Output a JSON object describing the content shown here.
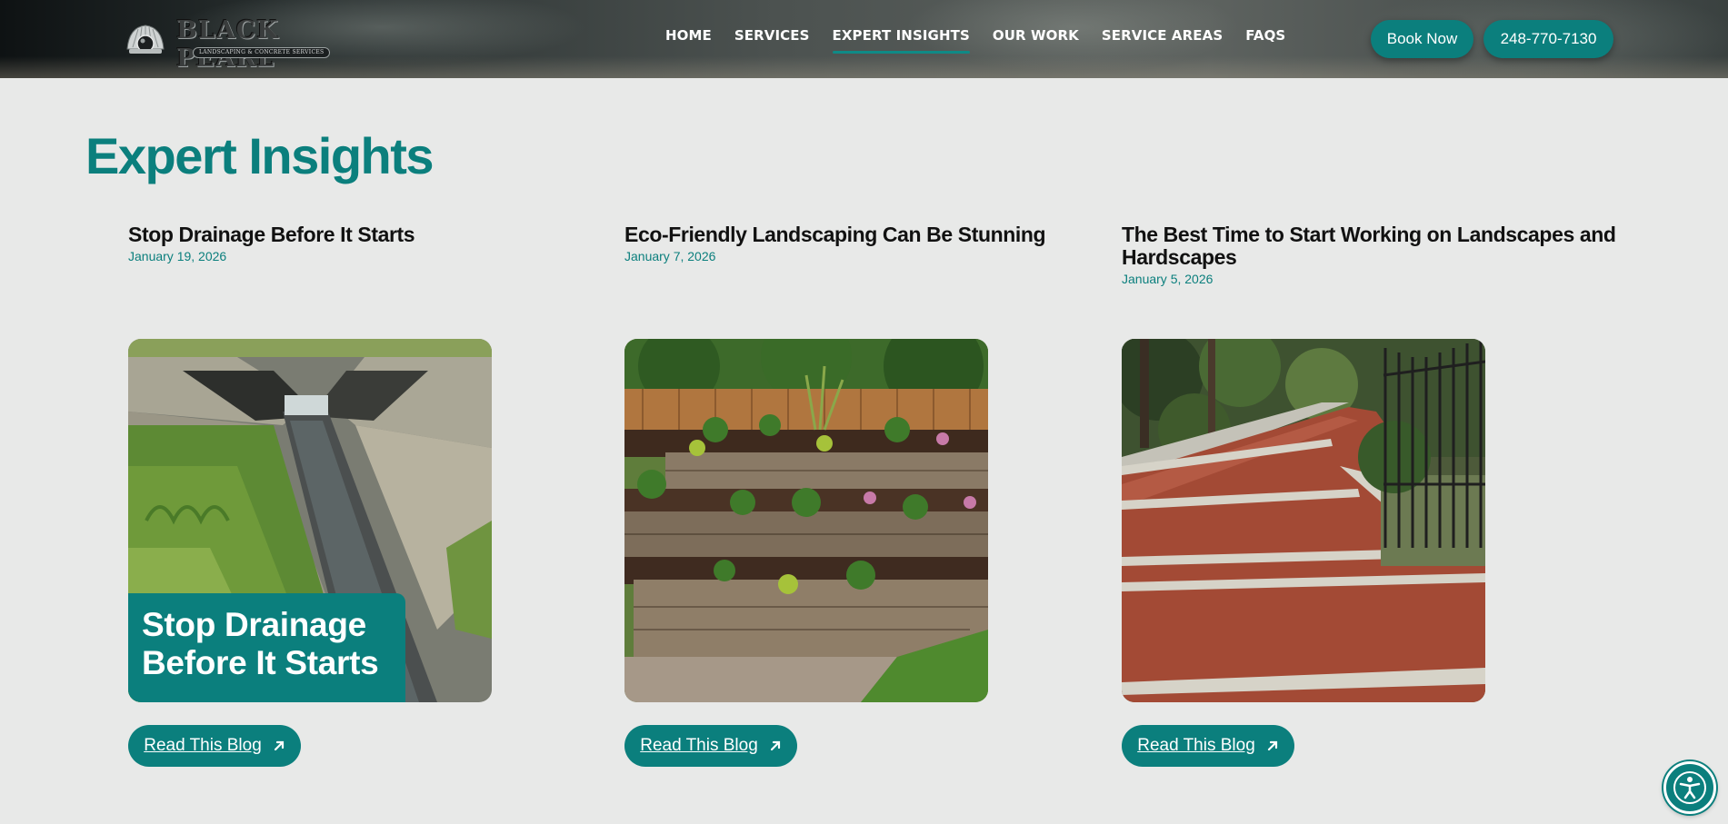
{
  "brand": {
    "name": "BLACK PEARL",
    "tagline": "LANDSCAPING & CONCRETE SERVICES"
  },
  "nav": {
    "items": [
      {
        "label": "HOME",
        "active": false
      },
      {
        "label": "SERVICES",
        "active": false
      },
      {
        "label": "EXPERT INSIGHTS",
        "active": true
      },
      {
        "label": "OUR WORK",
        "active": false
      },
      {
        "label": "SERVICE AREAS",
        "active": false
      },
      {
        "label": "FAQS",
        "active": false
      }
    ],
    "book_label": "Book Now",
    "phone_label": "248-770-7130"
  },
  "page": {
    "title": "Expert Insights"
  },
  "posts": [
    {
      "title": "Stop Drainage Before It Starts",
      "date": "January 19, 2026",
      "image_overlay": "Stop Drainage Before It Starts",
      "button": "Read This Blog"
    },
    {
      "title": "Eco-Friendly Landscaping Can Be Stunning",
      "date": "January 7, 2026",
      "button": "Read This Blog"
    },
    {
      "title": "The Best Time to Start Working on Landscapes and Hardscapes",
      "date": "January 5, 2026",
      "button": "Read This Blog"
    }
  ],
  "colors": {
    "accent": "#0b7f7d",
    "background": "#e8e9e8",
    "text": "#111111"
  },
  "icons": {
    "read_arrow": "arrow-up-right-icon",
    "accessibility": "accessibility-icon",
    "logo_mark": "pearl-shell-icon"
  }
}
